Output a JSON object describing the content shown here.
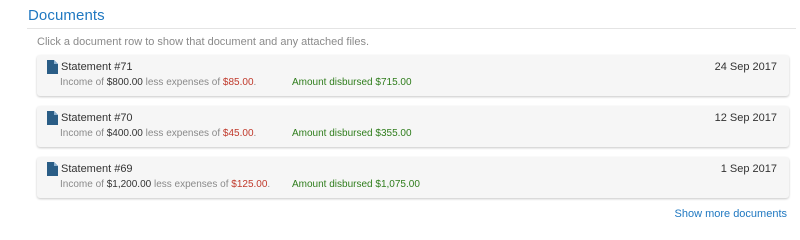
{
  "section": {
    "title": "Documents",
    "hint": "Click a document row to show that document and any attached files."
  },
  "documents": [
    {
      "title": "Statement #71",
      "date": "24 Sep 2017",
      "income_prefix": "Income of",
      "income": "$800.00",
      "expenses_prefix": "less expenses of",
      "expenses": "$85.00",
      "disbursed_label": "Amount disbursed",
      "disbursed": "$715.00",
      "icon": "document-icon"
    },
    {
      "title": "Statement #70",
      "date": "12 Sep 2017",
      "income_prefix": "Income of",
      "income": "$400.00",
      "expenses_prefix": "less expenses of",
      "expenses": "$45.00",
      "disbursed_label": "Amount disbursed",
      "disbursed": "$355.00",
      "icon": "document-icon"
    },
    {
      "title": "Statement #69",
      "date": "1 Sep 2017",
      "income_prefix": "Income of",
      "income": "$1,200.00",
      "expenses_prefix": "less expenses of",
      "expenses": "$125.00",
      "disbursed_label": "Amount disbursed",
      "disbursed": "$1,075.00",
      "icon": "document-icon"
    }
  ],
  "footer": {
    "show_more": "Show more documents"
  },
  "colors": {
    "accent": "#1f78c1",
    "expense": "#c0392b",
    "disbursed": "#2f7d1c",
    "icon": "#2a5d86"
  }
}
